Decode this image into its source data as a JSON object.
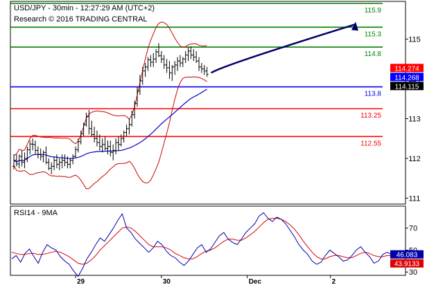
{
  "header": {
    "line1": "USD/JPY - 30min - 12:27:29 AM (UTC+2)",
    "line2": "Research © 2016 TRADING CENTRAL"
  },
  "colors": {
    "price": "#000000",
    "ma": "#0000cc",
    "bands": "#cc0000",
    "resistance": "#008000",
    "pivot": "#0000ff",
    "support": "#ff0000",
    "arrow": "#000066",
    "rsi": "#0000aa",
    "rsi_ma": "#dd0000",
    "last_price_badge": "#000000",
    "ma_badge": "#0000ff",
    "band_badge": "#ff0000"
  },
  "chart_data": [
    {
      "type": "candlestick",
      "title": "USD/JPY - 30min - 12:27:29 AM (UTC+2)",
      "ylim": [
        110.85,
        115.95
      ],
      "y_ticks": [
        111,
        112,
        113,
        114,
        115
      ],
      "x_ticks": [
        {
          "label": "29",
          "index": 23
        },
        {
          "label": "30",
          "index": 55
        },
        {
          "label": "Dec",
          "index": 87
        },
        {
          "label": "2",
          "index": 118
        }
      ],
      "candles": [
        [
          111.8,
          112.1,
          111.72,
          111.95
        ],
        [
          111.95,
          112.1,
          111.8,
          111.86
        ],
        [
          111.86,
          112.1,
          111.75,
          112.05
        ],
        [
          112.05,
          112.2,
          111.8,
          111.9
        ],
        [
          111.9,
          112.15,
          111.75,
          112.0
        ],
        [
          112.0,
          112.3,
          111.9,
          112.22
        ],
        [
          112.22,
          112.45,
          112.1,
          112.36
        ],
        [
          112.36,
          112.5,
          112.2,
          112.35
        ],
        [
          112.35,
          112.45,
          112.1,
          112.2
        ],
        [
          112.2,
          112.3,
          112.0,
          112.1
        ],
        [
          112.1,
          112.25,
          111.95,
          112.05
        ],
        [
          112.05,
          112.2,
          111.9,
          112.15
        ],
        [
          112.15,
          112.3,
          111.85,
          111.9
        ],
        [
          111.9,
          112.0,
          111.7,
          111.75
        ],
        [
          111.75,
          111.9,
          111.6,
          111.8
        ],
        [
          111.8,
          112.05,
          111.7,
          111.95
        ],
        [
          111.95,
          112.1,
          111.75,
          111.85
        ],
        [
          111.85,
          112.0,
          111.7,
          111.9
        ],
        [
          111.9,
          112.1,
          111.75,
          111.95
        ],
        [
          111.95,
          112.1,
          111.8,
          111.9
        ],
        [
          111.9,
          112.05,
          111.75,
          111.85
        ],
        [
          111.85,
          112.0,
          111.75,
          111.95
        ],
        [
          111.95,
          112.1,
          111.85,
          112.05
        ],
        [
          112.05,
          112.3,
          112.0,
          112.22
        ],
        [
          112.22,
          112.5,
          112.15,
          112.42
        ],
        [
          112.42,
          112.7,
          112.35,
          112.62
        ],
        [
          112.62,
          112.9,
          112.55,
          112.85
        ],
        [
          112.85,
          113.15,
          112.8,
          113.05
        ],
        [
          113.05,
          113.22,
          112.6,
          112.75
        ],
        [
          112.75,
          112.95,
          112.55,
          112.6
        ],
        [
          112.6,
          112.8,
          112.4,
          112.5
        ],
        [
          112.5,
          112.7,
          112.3,
          112.4
        ],
        [
          112.4,
          112.6,
          112.2,
          112.3
        ],
        [
          112.3,
          112.5,
          112.15,
          112.35
        ],
        [
          112.35,
          112.55,
          112.2,
          112.25
        ],
        [
          112.25,
          112.45,
          112.1,
          112.3
        ],
        [
          112.3,
          112.45,
          112.05,
          112.15
        ],
        [
          112.15,
          112.35,
          111.95,
          112.2
        ],
        [
          112.2,
          112.5,
          112.1,
          112.4
        ],
        [
          112.4,
          112.55,
          112.2,
          112.35
        ],
        [
          112.35,
          112.6,
          112.3,
          112.5
        ],
        [
          112.5,
          112.7,
          112.4,
          112.65
        ],
        [
          112.65,
          112.85,
          112.55,
          112.75
        ],
        [
          112.75,
          113.0,
          112.6,
          112.85
        ],
        [
          112.85,
          113.2,
          112.8,
          113.1
        ],
        [
          113.1,
          113.45,
          113.0,
          113.38
        ],
        [
          113.38,
          113.8,
          113.3,
          113.7
        ],
        [
          113.7,
          114.1,
          113.6,
          113.95
        ],
        [
          113.95,
          114.3,
          113.85,
          114.2
        ],
        [
          114.2,
          114.4,
          114.05,
          114.3
        ],
        [
          114.3,
          114.55,
          114.2,
          114.48
        ],
        [
          114.48,
          114.6,
          114.3,
          114.42
        ],
        [
          114.42,
          114.65,
          114.3,
          114.5
        ],
        [
          114.5,
          114.75,
          114.4,
          114.68
        ],
        [
          114.68,
          114.9,
          114.55,
          114.58
        ],
        [
          114.58,
          114.7,
          114.4,
          114.5
        ],
        [
          114.5,
          114.6,
          114.25,
          114.35
        ],
        [
          114.35,
          114.5,
          114.15,
          114.28
        ],
        [
          114.28,
          114.45,
          114.0,
          114.15
        ],
        [
          114.15,
          114.35,
          113.95,
          114.3
        ],
        [
          114.3,
          114.45,
          114.1,
          114.35
        ],
        [
          114.35,
          114.55,
          114.2,
          114.45
        ],
        [
          114.45,
          114.6,
          114.3,
          114.4
        ],
        [
          114.4,
          114.55,
          114.3,
          114.5
        ],
        [
          114.5,
          114.7,
          114.4,
          114.6
        ],
        [
          114.6,
          114.8,
          114.45,
          114.7
        ],
        [
          114.7,
          114.82,
          114.5,
          114.6
        ],
        [
          114.6,
          114.75,
          114.45,
          114.55
        ],
        [
          114.55,
          114.7,
          114.4,
          114.45
        ],
        [
          114.45,
          114.55,
          114.2,
          114.3
        ],
        [
          114.3,
          114.4,
          114.15,
          114.25
        ],
        [
          114.25,
          114.35,
          114.1,
          114.2
        ],
        [
          114.2,
          114.3,
          114.05,
          114.115
        ]
      ]
    },
    {
      "type": "rsi",
      "title": "RSI14 - 9MA",
      "ylim": [
        27,
        90
      ],
      "y_ticks": [
        30,
        50,
        70
      ],
      "series": [
        {
          "name": "RSI14",
          "values": [
            42,
            45,
            39,
            47,
            51,
            44,
            38,
            48,
            55,
            52,
            50,
            44,
            40,
            37,
            31,
            26,
            33,
            42,
            48,
            55,
            61,
            58,
            64,
            70,
            77,
            83,
            70,
            66,
            60,
            56,
            52,
            48,
            52,
            58,
            55,
            49,
            45,
            43,
            39,
            36,
            40,
            46,
            52,
            55,
            48,
            51,
            57,
            63,
            66,
            60,
            57,
            55,
            60,
            66,
            70,
            74,
            81,
            84,
            79,
            76,
            80,
            78,
            74,
            68,
            62,
            55,
            50,
            46,
            40,
            37,
            39,
            45,
            50,
            47,
            44,
            40,
            41,
            45,
            50,
            53,
            48,
            44,
            38,
            40,
            46,
            48,
            46
          ]
        },
        {
          "name": "9MA",
          "values": [
            48,
            47,
            46,
            46,
            47,
            47,
            46,
            46,
            47,
            48,
            49,
            48,
            46,
            44,
            41,
            38,
            37,
            38,
            41,
            45,
            50,
            54,
            58,
            62,
            66,
            70,
            71,
            70,
            67,
            63,
            59,
            55,
            53,
            53,
            53,
            52,
            50,
            47,
            45,
            43,
            42,
            42,
            44,
            47,
            49,
            50,
            52,
            55,
            58,
            60,
            60,
            59,
            59,
            61,
            64,
            67,
            71,
            75,
            78,
            79,
            79,
            78,
            76,
            73,
            69,
            64,
            58,
            53,
            48,
            44,
            42,
            42,
            44,
            45,
            45,
            44,
            43,
            43,
            45,
            47,
            48,
            47,
            45,
            44,
            44,
            45,
            45
          ]
        }
      ]
    }
  ],
  "levels": [
    {
      "label": "115.9",
      "value": 115.9,
      "kind": "resistance"
    },
    {
      "label": "115.3",
      "value": 115.3,
      "kind": "resistance"
    },
    {
      "label": "114.8",
      "value": 114.8,
      "kind": "resistance"
    },
    {
      "label": "113.8",
      "value": 113.8,
      "kind": "pivot"
    },
    {
      "label": "113.25",
      "value": 113.25,
      "kind": "support"
    },
    {
      "label": "112.55",
      "value": 112.55,
      "kind": "support"
    }
  ],
  "badges": [
    {
      "label": "114.274",
      "value": 114.274,
      "kind": "band"
    },
    {
      "label": "114.268",
      "value": 114.268,
      "kind": "ma"
    },
    {
      "label": "114.115",
      "value": 114.115,
      "kind": "price"
    }
  ],
  "rsi_badges": [
    {
      "label": "46.083",
      "value": 46.083,
      "kind": "rsi"
    },
    {
      "label": "43.9133",
      "value": 43.9133,
      "kind": "rsi_ma"
    }
  ],
  "scales": {
    "price_ticks": [
      "111",
      "112",
      "113",
      "114",
      "115"
    ],
    "rsi_ticks": [
      "30",
      "50",
      "70"
    ]
  }
}
